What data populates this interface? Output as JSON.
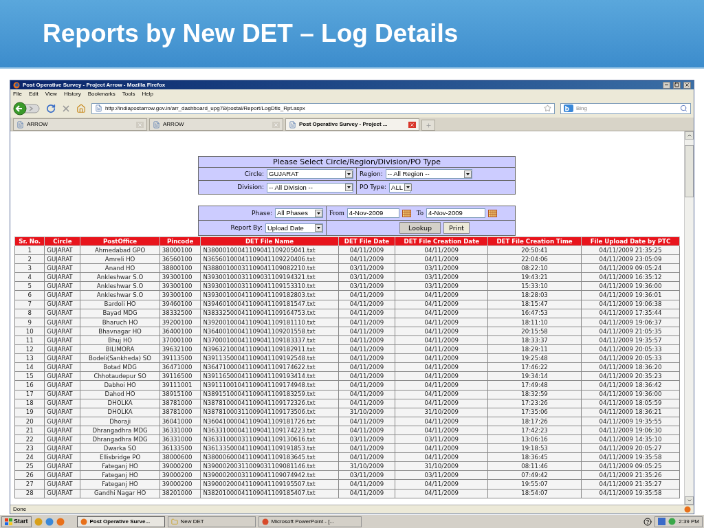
{
  "slide": {
    "title": "Reports by New DET – Log Details"
  },
  "window": {
    "title": "Post Operative Survey - Project Arrow - Mozilla Firefox"
  },
  "menu": [
    "File",
    "Edit",
    "View",
    "History",
    "Bookmarks",
    "Tools",
    "Help"
  ],
  "address": {
    "value": "http://indiapostarrow.gov.in/arr_dashboard_upg78/postal/Report/LogDtls_Rpt.aspx"
  },
  "search": {
    "placeholder": "Bing"
  },
  "tabs": [
    {
      "label": "ARROW",
      "selected": false
    },
    {
      "label": "ARROW",
      "selected": false
    },
    {
      "label": "Post Operative Survey - Project ...",
      "selected": true
    }
  ],
  "filter": {
    "title": "Please Select Circle/Region/Division/PO Type",
    "rows": [
      [
        {
          "label": "Circle:",
          "value": "GUJARAT"
        },
        {
          "label": "Region:",
          "value": "-- All Region --"
        }
      ],
      [
        {
          "label": "Division:",
          "value": "-- All Division --"
        },
        {
          "label": "PO Type:",
          "value": "ALL"
        }
      ]
    ]
  },
  "report": {
    "phase": {
      "label": "Phase:",
      "value": "All Phases"
    },
    "from": {
      "label": "From",
      "value": "4-Nov-2009"
    },
    "to": {
      "label": "To",
      "value": "4-Nov-2009"
    },
    "report_by": {
      "label": "Report By:",
      "value": "Upload Date"
    },
    "buttons": [
      "Lookup",
      "Print"
    ]
  },
  "table": {
    "columns": [
      "Sr. No.",
      "Circle",
      "PostOffice",
      "Pincode",
      "DET File Name",
      "DET File Date",
      "DET File Creation Date",
      "DET File Creation Time",
      "File Upload Date by PTC"
    ],
    "rows": [
      [
        "1",
        "GUJARAT",
        "Ahmedabad GPO",
        "38000100",
        "N38000100041109041109205041.txt",
        "04/11/2009",
        "04/11/2009",
        "20:50:41",
        "04/11/2009 21:35:25"
      ],
      [
        "2",
        "GUJARAT",
        "Amreli HO",
        "36560100",
        "N36560100041109041109220406.txt",
        "04/11/2009",
        "04/11/2009",
        "22:04:06",
        "04/11/2009 23:05:09"
      ],
      [
        "3",
        "GUJARAT",
        "Anand HO",
        "38800100",
        "N38800100031109041109082210.txt",
        "03/11/2009",
        "03/11/2009",
        "08:22:10",
        "04/11/2009 09:05:24"
      ],
      [
        "4",
        "GUJARAT",
        "Ankleshwar S.O",
        "39300100",
        "N39300100031109031109194321.txt",
        "03/11/2009",
        "03/11/2009",
        "19:43:21",
        "04/11/2009 16:35:12"
      ],
      [
        "5",
        "GUJARAT",
        "Ankleshwar S.O",
        "39300100",
        "N39300100031109041109153310.txt",
        "03/11/2009",
        "03/11/2009",
        "15:33:10",
        "04/11/2009 19:36:00"
      ],
      [
        "6",
        "GUJARAT",
        "Ankleshwar S.O",
        "39300100",
        "N39300100041109041109182803.txt",
        "04/11/2009",
        "04/11/2009",
        "18:28:03",
        "04/11/2009 19:36:01"
      ],
      [
        "7",
        "GUJARAT",
        "Bardoli HO",
        "39460100",
        "N39460100041109041109181547.txt",
        "04/11/2009",
        "04/11/2009",
        "18:15:47",
        "04/11/2009 19:06:38"
      ],
      [
        "8",
        "GUJARAT",
        "Bayad MDG",
        "38332500",
        "N38332500041109041109164753.txt",
        "04/11/2009",
        "04/11/2009",
        "16:47:53",
        "04/11/2009 17:35:44"
      ],
      [
        "9",
        "GUJARAT",
        "Bharuch HO",
        "39200100",
        "N39200100041109041109181110.txt",
        "04/11/2009",
        "04/11/2009",
        "18:11:10",
        "04/11/2009 19:06:37"
      ],
      [
        "10",
        "GUJARAT",
        "Bhavnagar HO",
        "36400100",
        "N36400100041109041109201558.txt",
        "04/11/2009",
        "04/11/2009",
        "20:15:58",
        "04/11/2009 21:05:35"
      ],
      [
        "11",
        "GUJARAT",
        "Bhuj HO",
        "37000100",
        "N37000100041109041109183337.txt",
        "04/11/2009",
        "04/11/2009",
        "18:33:37",
        "04/11/2009 19:35:57"
      ],
      [
        "12",
        "GUJARAT",
        "BILIMORA",
        "39632100",
        "N39632100041109041109182911.txt",
        "04/11/2009",
        "04/11/2009",
        "18:29:11",
        "04/11/2009 20:05:33"
      ],
      [
        "13",
        "GUJARAT",
        "Bodeli(Sankheda) SO",
        "39113500",
        "N39113500041109041109192548.txt",
        "04/11/2009",
        "04/11/2009",
        "19:25:48",
        "04/11/2009 20:05:33"
      ],
      [
        "14",
        "GUJARAT",
        "Botad MDG",
        "36471000",
        "N36471000041109041109174622.txt",
        "04/11/2009",
        "04/11/2009",
        "17:46:22",
        "04/11/2009 18:36:20"
      ],
      [
        "15",
        "GUJARAT",
        "Chhotaudepur SO",
        "39116500",
        "N39116500041109041109193414.txt",
        "04/11/2009",
        "04/11/2009",
        "19:34:14",
        "04/11/2009 20:35:23"
      ],
      [
        "16",
        "GUJARAT",
        "Dabhoi HO",
        "39111001",
        "N39111001041109041109174948.txt",
        "04/11/2009",
        "04/11/2009",
        "17:49:48",
        "04/11/2009 18:36:42"
      ],
      [
        "17",
        "GUJARAT",
        "Dahod HO",
        "38915100",
        "N38915100041109041109183259.txt",
        "04/11/2009",
        "04/11/2009",
        "18:32:59",
        "04/11/2009 19:36:00"
      ],
      [
        "18",
        "GUJARAT",
        "DHOLKA",
        "38781000",
        "N38781000041109041109172326.txt",
        "04/11/2009",
        "04/11/2009",
        "17:23:26",
        "04/11/2009 18:05:59"
      ],
      [
        "19",
        "GUJARAT",
        "DHOLKA",
        "38781000",
        "N38781000311009041109173506.txt",
        "31/10/2009",
        "31/10/2009",
        "17:35:06",
        "04/11/2009 18:36:21"
      ],
      [
        "20",
        "GUJARAT",
        "Dhoraji",
        "36041000",
        "N36041000041109041109181726.txt",
        "04/11/2009",
        "04/11/2009",
        "18:17:26",
        "04/11/2009 19:35:55"
      ],
      [
        "21",
        "GUJARAT",
        "Dhrangadhra MDG",
        "36331000",
        "N36331000041109041109174223.txt",
        "04/11/2009",
        "04/11/2009",
        "17:42:23",
        "04/11/2009 19:06:30"
      ],
      [
        "22",
        "GUJARAT",
        "Dhrangadhra MDG",
        "36331000",
        "N36331000031109041109130616.txt",
        "03/11/2009",
        "03/11/2009",
        "13:06:16",
        "04/11/2009 14:35:10"
      ],
      [
        "23",
        "GUJARAT",
        "Dwarka SO",
        "36133500",
        "N36133500041109041109191853.txt",
        "04/11/2009",
        "04/11/2009",
        "19:18:53",
        "04/11/2009 20:05:27"
      ],
      [
        "24",
        "GUJARAT",
        "Ellisbridge PO",
        "38000600",
        "N38000600041109041109183645.txt",
        "04/11/2009",
        "04/11/2009",
        "18:36:45",
        "04/11/2009 19:35:58"
      ],
      [
        "25",
        "GUJARAT",
        "Fateganj HO",
        "39000200",
        "N39000200311009031109081146.txt",
        "31/10/2009",
        "31/10/2009",
        "08:11:46",
        "04/11/2009 09:05:25"
      ],
      [
        "26",
        "GUJARAT",
        "Fateganj HO",
        "39000200",
        "N39000200031109041109074942.txt",
        "03/11/2009",
        "03/11/2009",
        "07:49:42",
        "04/11/2009 21:35:26"
      ],
      [
        "27",
        "GUJARAT",
        "Fateganj HO",
        "39000200",
        "N39000200041109041109195507.txt",
        "04/11/2009",
        "04/11/2009",
        "19:55:07",
        "04/11/2009 21:35:27"
      ],
      [
        "28",
        "GUJARAT",
        "Gandhi Nagar HO",
        "38201000",
        "N38201000041109041109185407.txt",
        "04/11/2009",
        "04/11/2009",
        "18:54:07",
        "04/11/2009 19:35:58"
      ]
    ]
  },
  "status_bar": {
    "text": "Done"
  },
  "taskbar": {
    "start": "Start",
    "tasks": [
      {
        "label": "Post Operative Surve...",
        "selected": true
      },
      {
        "label": "New DET",
        "selected": false
      },
      {
        "label": "Microsoft PowerPoint - [...",
        "selected": false
      }
    ],
    "clock": "2:39 PM"
  }
}
